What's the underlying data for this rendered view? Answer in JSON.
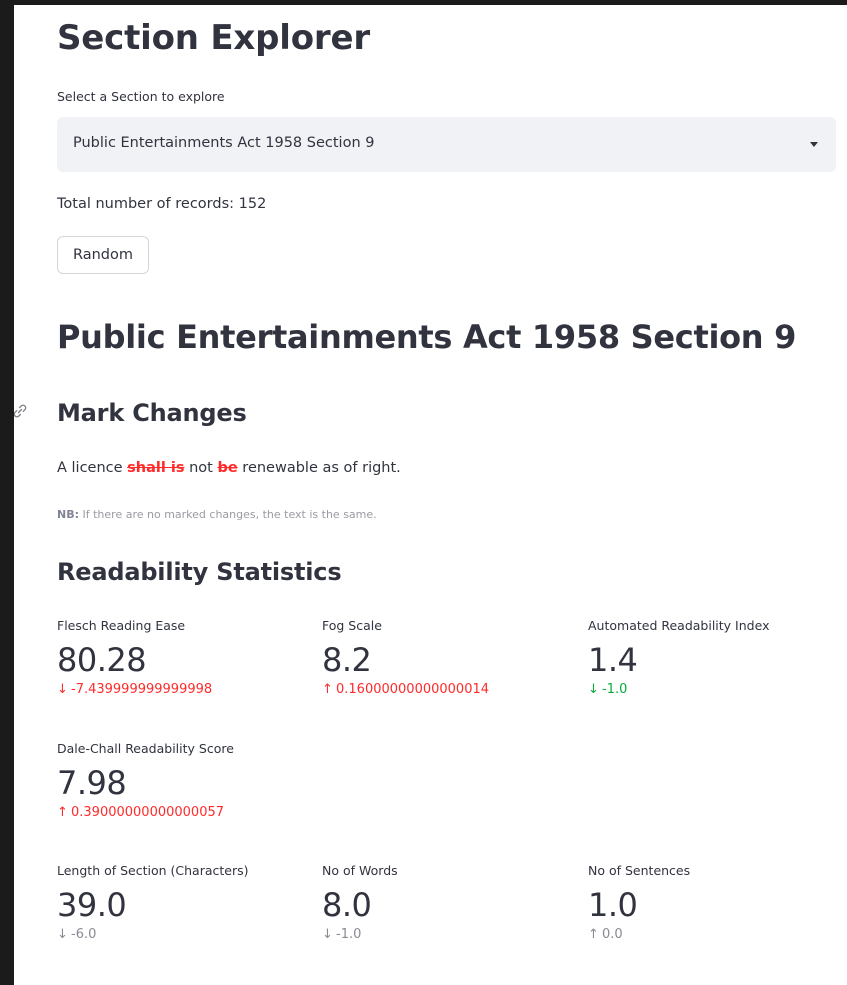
{
  "page_title": "Section Explorer",
  "select": {
    "label": "Select a Section to explore",
    "value": "Public Entertainments Act 1958 Section 9",
    "caret_icon": "caret-down-icon"
  },
  "total_records_text": "Total number of records: 152",
  "random_button": "Random",
  "section_heading": "Public Entertainments Act 1958 Section 9",
  "mark_changes": {
    "heading": "Mark Changes",
    "link_icon": "link-icon",
    "text_before": "A licence ",
    "removed_1": "shall is",
    "text_mid": " not ",
    "removed_2": "be",
    "text_after": " renewable as of right.",
    "nb_label": "NB:",
    "nb_text": " If there are no marked changes, the text is the same."
  },
  "readability": {
    "heading": "Readability Statistics",
    "metrics": [
      {
        "label": "Flesch Reading Ease",
        "value": "80.28",
        "arrow": "↓",
        "delta": "-7.439999999999998",
        "color": "#ff2b2b"
      },
      {
        "label": "Fog Scale",
        "value": "8.2",
        "arrow": "↑",
        "delta": "0.16000000000000014",
        "color": "#ff2b2b"
      },
      {
        "label": "Automated Readability Index",
        "value": "1.4",
        "arrow": "↓",
        "delta": "-1.0",
        "color": "#09ab3b"
      },
      {
        "label": "Dale-Chall Readability Score",
        "value": "7.98",
        "arrow": "↑",
        "delta": "0.39000000000000057",
        "color": "#ff2b2b"
      },
      {
        "label": "Length of Section (Characters)",
        "value": "39.0",
        "arrow": "↓",
        "delta": "-6.0",
        "color": "#8a8a94"
      },
      {
        "label": "No of Words",
        "value": "8.0",
        "arrow": "↓",
        "delta": "-1.0",
        "color": "#8a8a94"
      },
      {
        "label": "No of Sentences",
        "value": "1.0",
        "arrow": "↑",
        "delta": "0.0",
        "color": "#8a8a94"
      }
    ]
  }
}
